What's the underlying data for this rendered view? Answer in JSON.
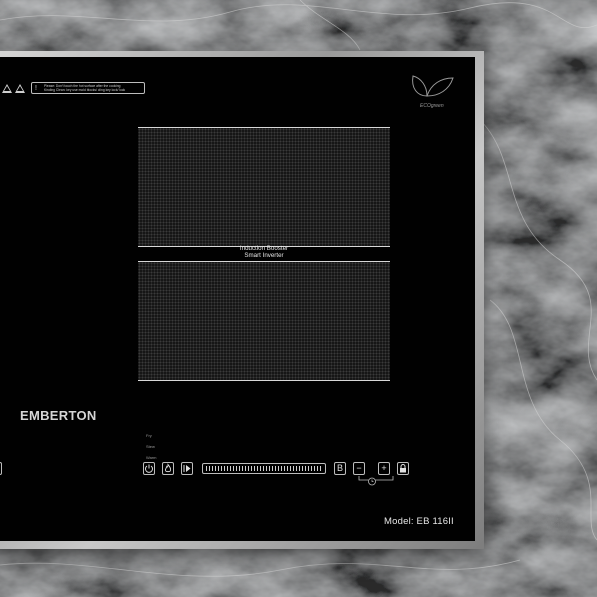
{
  "brand": "EMBERTON",
  "model_label": "Model: EB 116II",
  "booster": {
    "line1": "Induction Booster",
    "line2": "Smart Inverter"
  },
  "eco_text": "ECOgreen",
  "warning": {
    "line1": "Please: Don't touch the hot surface after the cooking",
    "line2": "Kinding Clean: key use mold blocks/ cling key lock/ lock"
  },
  "modes": [
    "Fry",
    "Stew",
    "Warm"
  ],
  "controls": {
    "buttons_left": [
      "power-icon",
      "flame-icon",
      "play-icon"
    ],
    "buttons_right": [
      {
        "icon": "boost-icon",
        "label": "B"
      },
      {
        "icon": "minus-icon",
        "label": "−"
      },
      {
        "icon": "plus-icon",
        "label": "+"
      },
      {
        "icon": "lock-icon",
        "label": ""
      }
    ],
    "timer_icon": "clock-icon"
  },
  "colors": {
    "glass": "#010101",
    "frame": "#b8b8b8",
    "text": "#e6e6e6",
    "zone_line": "#d8d8d8"
  }
}
